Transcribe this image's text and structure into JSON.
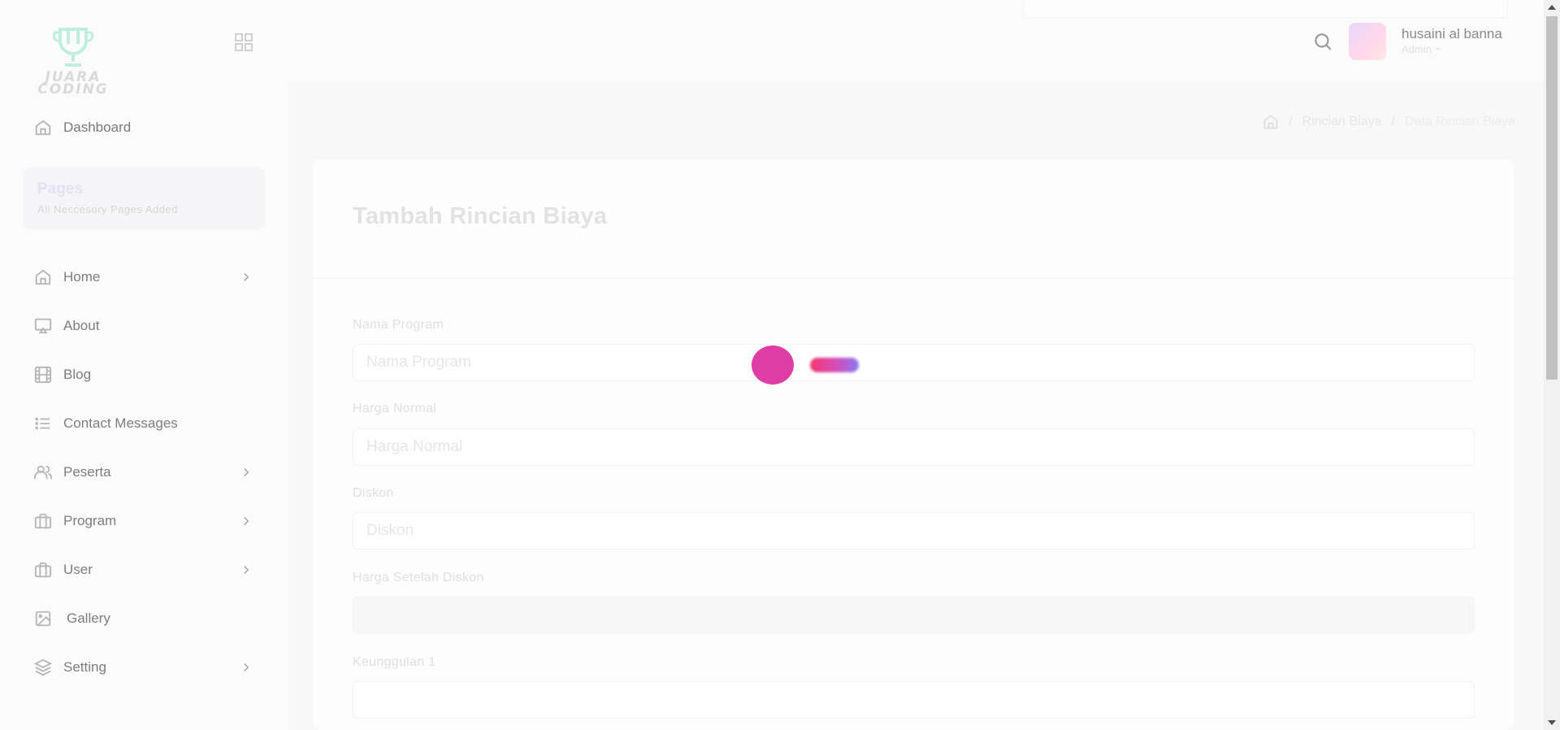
{
  "brand": {
    "logo_text": "JUARA CODING"
  },
  "sidebar": {
    "dashboard_label": "Dashboard",
    "section": {
      "title": "Pages",
      "subtitle": "All Neccesory Pages Added"
    },
    "items": [
      {
        "label": "Home",
        "icon": "home-icon",
        "has_submenu": true
      },
      {
        "label": "About",
        "icon": "airplay-icon",
        "has_submenu": false
      },
      {
        "label": "Blog",
        "icon": "film-icon",
        "has_submenu": false
      },
      {
        "label": "Contact Messages",
        "icon": "list-icon",
        "has_submenu": false
      },
      {
        "label": "Peserta",
        "icon": "users-icon",
        "has_submenu": true
      },
      {
        "label": "Program",
        "icon": "briefcase-icon",
        "has_submenu": true
      },
      {
        "label": "User",
        "icon": "briefcase-icon",
        "has_submenu": true
      },
      {
        "label": "Gallery",
        "icon": "image-icon",
        "has_submenu": false
      },
      {
        "label": "Setting",
        "icon": "layers-icon",
        "has_submenu": true
      }
    ]
  },
  "header": {
    "user_name": "husaini al banna",
    "user_role": "Admin"
  },
  "breadcrumb": {
    "items": [
      "Rincian Biaya",
      "Data Rincian Biaya"
    ]
  },
  "form": {
    "title": "Tambah Rincian Biaya",
    "fields": [
      {
        "label": "Nama Program",
        "placeholder": "Nama Program",
        "value": ""
      },
      {
        "label": "Harga Normal",
        "placeholder": "Harga Normal",
        "value": ""
      },
      {
        "label": "Diskon",
        "placeholder": "Diskon",
        "value": ""
      },
      {
        "label": "Harga Setelah Diskon",
        "placeholder": "",
        "value": ""
      },
      {
        "label": "Keunggulan 1",
        "placeholder": "",
        "value": ""
      }
    ]
  },
  "colors": {
    "loader_primary": "#de3ea3",
    "loader_trail_start": "#f0386e",
    "loader_trail_end": "#8b78f0"
  }
}
